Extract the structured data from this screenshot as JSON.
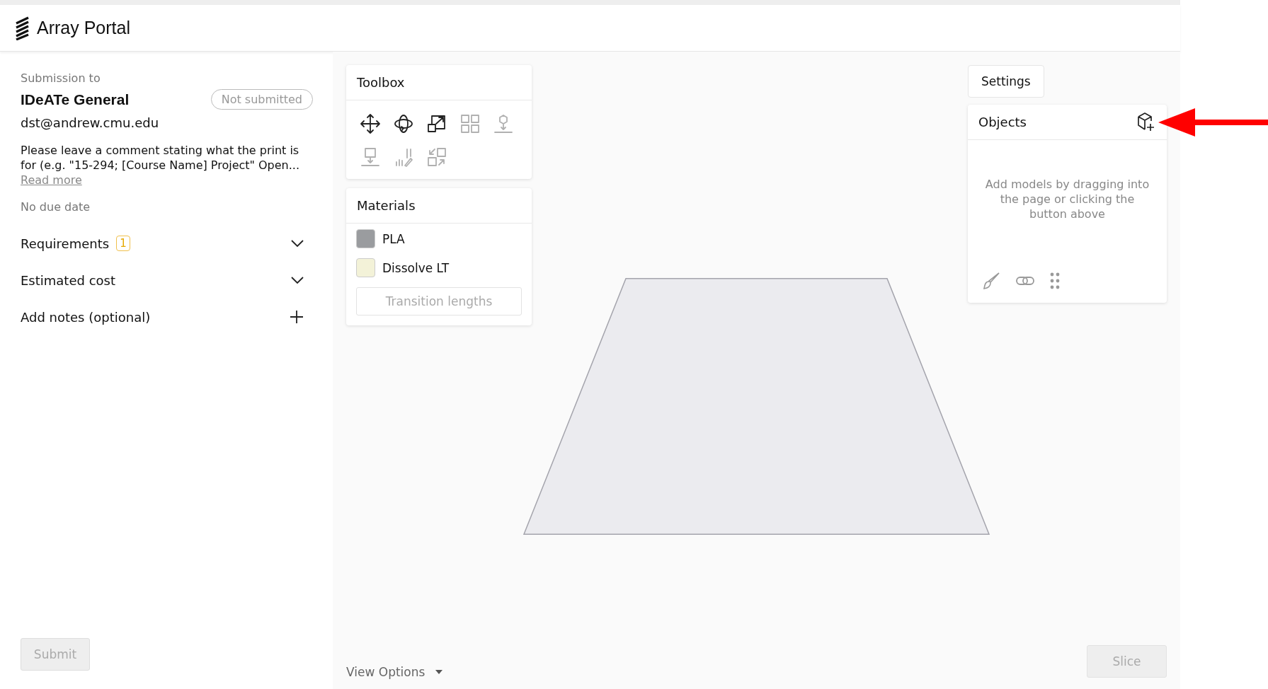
{
  "app": {
    "title": "Array Portal"
  },
  "submission": {
    "label": "Submission to",
    "name": "IDeATe General",
    "status": "Not submitted",
    "email": "dst@andrew.cmu.edu",
    "description": "Please leave a comment stating what the print is for (e.g. \"15-294; [Course Name] Project\" Open...",
    "read_more": "Read more",
    "due_date": "No due date",
    "sections": [
      {
        "label": "Requirements",
        "badge": "1",
        "kind": "chevron"
      },
      {
        "label": "Estimated cost",
        "kind": "chevron"
      },
      {
        "label": "Add notes (optional)",
        "kind": "plus"
      }
    ],
    "submit": {
      "label": "Submit",
      "disabled": true
    }
  },
  "toolbox": {
    "title": "Toolbox",
    "tools": [
      {
        "kind": "move",
        "disabled": false
      },
      {
        "kind": "rotate",
        "disabled": false
      },
      {
        "kind": "scale",
        "disabled": false
      },
      {
        "kind": "arrange",
        "disabled": true
      },
      {
        "kind": "layflat",
        "disabled": true
      },
      {
        "kind": "drop",
        "disabled": true
      },
      {
        "kind": "supports",
        "disabled": true
      },
      {
        "kind": "swap",
        "disabled": true
      }
    ]
  },
  "materials": {
    "title": "Materials",
    "items": [
      {
        "name": "PLA",
        "color": "#9a9c9f"
      },
      {
        "name": "Dissolve LT",
        "color": "#f3f2d8"
      }
    ],
    "transition": {
      "label": "Transition lengths",
      "disabled": true
    }
  },
  "settings": {
    "label": "Settings"
  },
  "objects": {
    "title": "Objects",
    "empty_text": "Add models by dragging into the page or clicking the button above"
  },
  "view_options": {
    "label": "View Options"
  },
  "slice": {
    "label": "Slice",
    "disabled": true
  }
}
